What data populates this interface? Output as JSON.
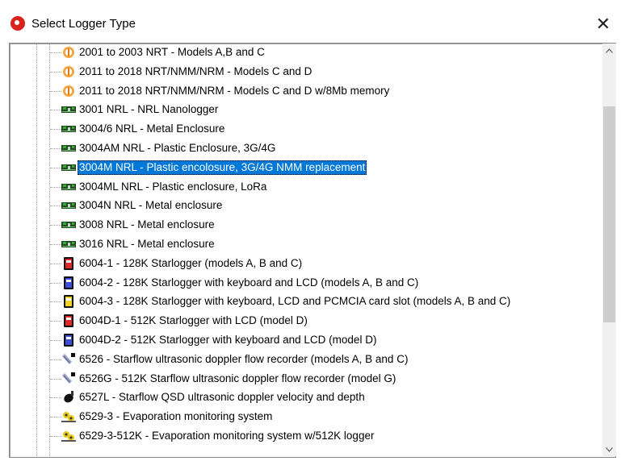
{
  "window": {
    "title": "Select Logger Type",
    "close_glyph": "✕",
    "app_icon": "app-logo-icon"
  },
  "tree": {
    "selected_index": 6,
    "items": [
      {
        "label": "2001 to 2003 NRT - Models A,B and C",
        "icon": "nrt-orange-icon"
      },
      {
        "label": "2011 to 2018 NRT/NMM/NRM - Models C and D",
        "icon": "nrt-orange-icon"
      },
      {
        "label": "2011 to 2018 NRT/NMM/NRM - Models C and D w/8Mb memory",
        "icon": "nrt-orange-icon"
      },
      {
        "label": "3001 NRL - NRL Nanologger",
        "icon": "circuit-board-icon"
      },
      {
        "label": "3004/6 NRL - Metal Enclosure",
        "icon": "circuit-board-icon"
      },
      {
        "label": "3004AM NRL - Plastic Enclosure, 3G/4G",
        "icon": "circuit-board-icon"
      },
      {
        "label": "3004M NRL - Plastic encolosure, 3G/4G NMM replacement",
        "icon": "circuit-board-icon"
      },
      {
        "label": "3004ML NRL - Plastic enclosure, LoRa",
        "icon": "circuit-board-icon"
      },
      {
        "label": "3004N NRL - Metal enclosure",
        "icon": "circuit-board-icon"
      },
      {
        "label": "3008 NRL - Metal enclosure",
        "icon": "circuit-board-icon"
      },
      {
        "label": "3016 NRL - Metal enclosure",
        "icon": "circuit-board-icon"
      },
      {
        "label": "6004-1 - 128K Starlogger (models A, B and C)",
        "icon": "starlogger-red-icon"
      },
      {
        "label": "6004-2 - 128K Starlogger with keyboard and LCD (models A, B and C)",
        "icon": "starlogger-blue-icon"
      },
      {
        "label": "6004-3 - 128K Starlogger with keyboard, LCD and PCMCIA card slot (models A, B and C)",
        "icon": "starlogger-yellow-icon"
      },
      {
        "label": "6004D-1 - 512K Starlogger with LCD (model D)",
        "icon": "starlogger-red-icon"
      },
      {
        "label": "6004D-2 - 512K Starlogger with keyboard and LCD (model D)",
        "icon": "starlogger-blue-icon"
      },
      {
        "label": "6526 - Starflow ultrasonic doppler flow recorder (models A, B and C)",
        "icon": "starflow-probe-icon"
      },
      {
        "label": "6526G - 512K Starflow ultrasonic doppler flow recorder (model G)",
        "icon": "starflow-probe-icon"
      },
      {
        "label": "6527L - Starflow QSD ultrasonic doppler velocity and depth",
        "icon": "qsd-sensor-icon"
      },
      {
        "label": "6529-3 - Evaporation monitoring system",
        "icon": "evaporation-system-icon"
      },
      {
        "label": "6529-3-512K - Evaporation monitoring system w/512K logger",
        "icon": "evaporation-system-icon"
      }
    ]
  },
  "colors": {
    "selection": "#0078d7",
    "accent_red": "#d9231c"
  }
}
